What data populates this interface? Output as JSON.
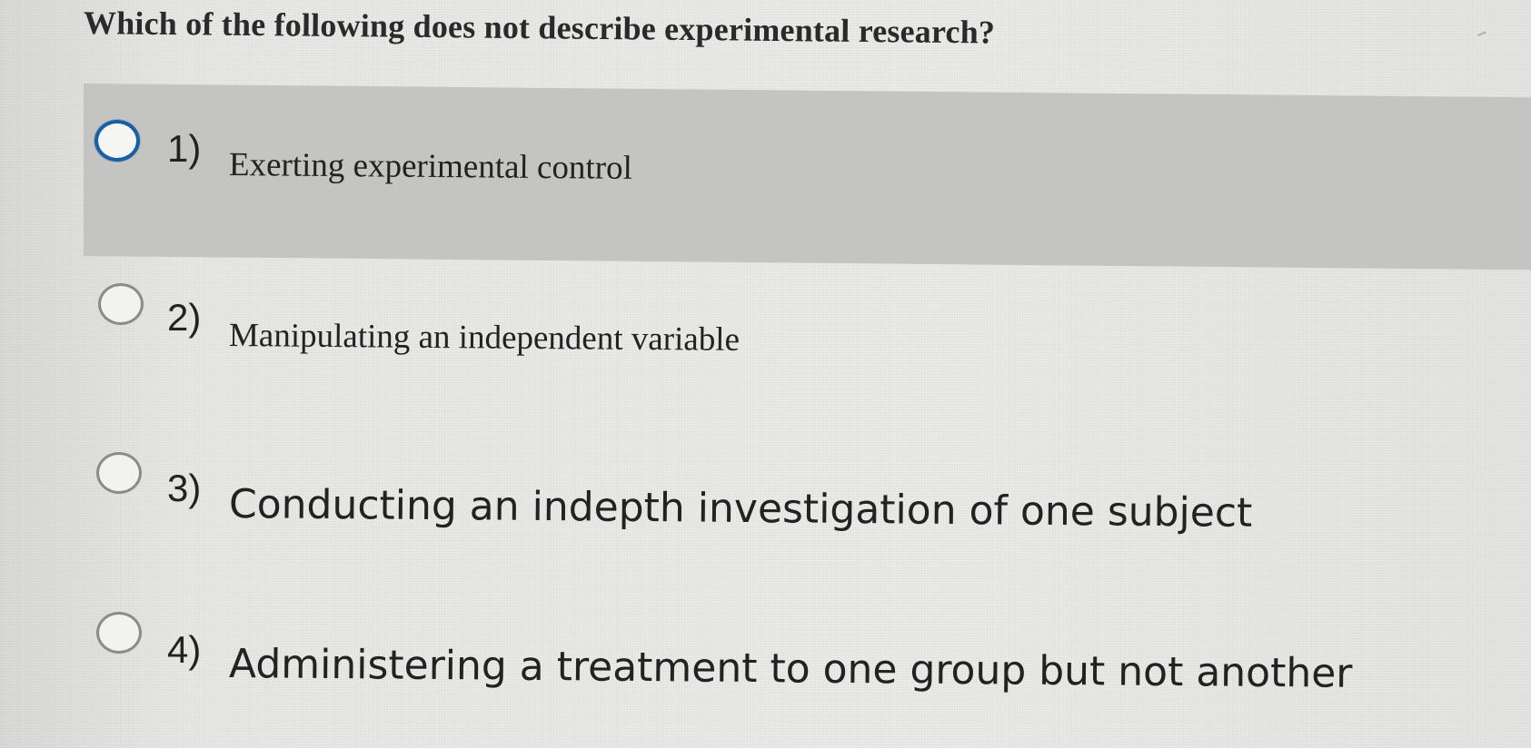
{
  "question": {
    "text": "Which of the following does not describe experimental research?"
  },
  "options": [
    {
      "number": "1)",
      "label": "Exerting experimental control",
      "selected": false
    },
    {
      "number": "2)",
      "label": "Manipulating an independent variable",
      "selected": false
    },
    {
      "number": "3)",
      "label": "Conducting an indepth investigation of one subject",
      "selected": false
    },
    {
      "number": "4)",
      "label": "Administering a treatment to one group but not another",
      "selected": false
    }
  ],
  "colors": {
    "background": "#e6e6e4",
    "highlight_row": "#c4c4c2",
    "focus_ring": "#1b5fa3",
    "text": "#222222"
  },
  "icons": {
    "radio": "radio-button-icon"
  }
}
